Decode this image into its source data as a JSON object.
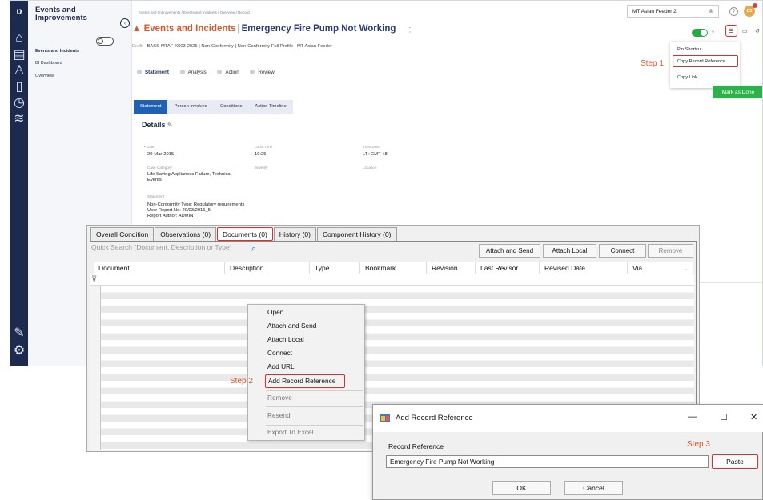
{
  "app": {
    "module_title": "Events and Improvements",
    "sidebar_items": [
      "Events and Incidents",
      "BI Dashboard",
      "Overview"
    ],
    "breadcrumb": [
      "Events and Improvements",
      "Events and Incidents",
      "Overview",
      "Record"
    ],
    "vessel_select": "MT Asian Feeder 2",
    "avatar_initials": "CS",
    "title_module": "Events and Incidents",
    "title_record": "Emergency Fire Pump Not Working",
    "status": "Draft",
    "meta": "BASS-MTAF-X003-2025 | Non-Conformity | Non-Conformity Full Profile | MT Asian Feeder",
    "workflow_steps": [
      "Statement",
      "Analysis",
      "Action",
      "Review"
    ],
    "tabs": [
      "Statement",
      "Person Involved",
      "Conditions",
      "Action Timeline"
    ],
    "details_heading": "Details",
    "fields": {
      "date_label": "• Date",
      "date_value": "20-Mar-2015",
      "local_time_label": "Local Time",
      "local_time_value": "19:25",
      "time_zone_label": "Time Zone",
      "time_zone_value": "LT+GMT +8",
      "case_category_label": "Case Category",
      "case_category_value": "Life Saving Appliances Failure, Technical Events",
      "severity_label": "Severity",
      "location_label": "Location",
      "statement_label": "Statement",
      "statement_lines": [
        "Non-Conformity Type: Regulatory requirements",
        "User Report No: 20/03/2015_5",
        "Report Author: ADMIN"
      ]
    },
    "menu": [
      "Pin Shortcut",
      "Copy Record Reference",
      "Copy Link"
    ],
    "mark_done": "Mark as Done",
    "step1": "Step 1"
  },
  "panel": {
    "tabs": [
      "Overall Condition",
      "Observations (0)",
      "Documents (0)",
      "History (0)",
      "Component History (0)"
    ],
    "search_placeholder": "Quick Search (Document, Description or Type)",
    "buttons": [
      "Attach and Send",
      "Attach Local",
      "Connect",
      "Remove"
    ],
    "columns": [
      "Document",
      "Description",
      "Type",
      "Bookmark",
      "Revision",
      "Last Revisor",
      "Revised Date",
      "Via"
    ],
    "context_menu": [
      "Open",
      "Attach and Send",
      "Attach Local",
      "Connect",
      "Add URL",
      "Add Record Reference",
      "Remove",
      "Resend",
      "Export To Excel"
    ],
    "step2": "Step 2"
  },
  "dialog": {
    "title": "Add Record Reference",
    "field_label": "Record Reference",
    "field_value": "Emergency Fire Pump Not Working",
    "paste": "Paste",
    "ok": "OK",
    "cancel": "Cancel",
    "step3": "Step 3"
  },
  "colors": {
    "accent_red": "#d9302b",
    "nav_dark": "#1b2a4e",
    "brand_orange": "#e0542a",
    "green": "#2db14a"
  }
}
